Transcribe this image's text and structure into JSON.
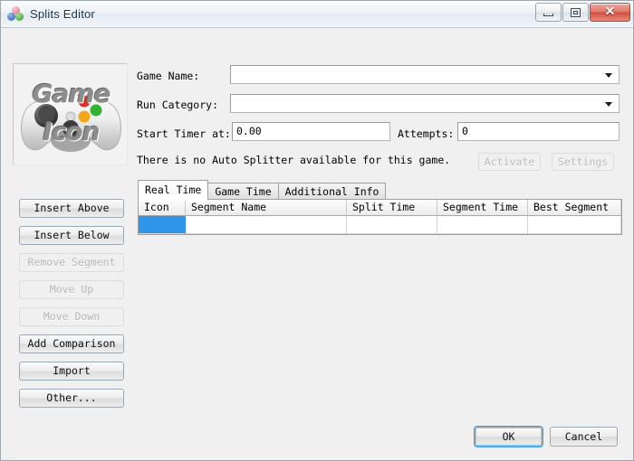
{
  "window": {
    "title": "Splits Editor",
    "icon": "livesplit-icon",
    "controls": {
      "minimize": "minimize-icon",
      "maximize": "maximize-icon",
      "close": "close-icon",
      "close_glyph": "✕"
    }
  },
  "game_icon": {
    "line1": "Game",
    "line2": "Icon",
    "image": "gamepad-placeholder"
  },
  "form": {
    "game_name_label": "Game Name:",
    "game_name_value": "",
    "run_category_label": "Run Category:",
    "run_category_value": "",
    "start_timer_label": "Start Timer at:",
    "start_timer_value": "0.00",
    "attempts_label": "Attempts:",
    "attempts_value": "0",
    "auto_splitter_note": "There is no Auto Splitter available for this game.",
    "activate_label": "Activate",
    "settings_label": "Settings"
  },
  "side_buttons": [
    {
      "label": "Insert Above",
      "enabled": true
    },
    {
      "label": "Insert Below",
      "enabled": true
    },
    {
      "label": "Remove Segment",
      "enabled": false
    },
    {
      "label": "Move Up",
      "enabled": false
    },
    {
      "label": "Move Down",
      "enabled": false
    },
    {
      "label": "Add Comparison",
      "enabled": true
    },
    {
      "label": "Import",
      "enabled": true
    },
    {
      "label": "Other...",
      "enabled": true
    }
  ],
  "tabs": [
    {
      "label": "Real Time",
      "active": true
    },
    {
      "label": "Game Time",
      "active": false
    },
    {
      "label": "Additional Info",
      "active": false
    }
  ],
  "table": {
    "columns": [
      "Icon",
      "Segment Name",
      "Split Time",
      "Segment Time",
      "Best Segment"
    ],
    "rows": [
      {
        "icon": "",
        "segment_name": "",
        "split_time": "",
        "segment_time": "",
        "best_segment": "",
        "selected_cell": "icon"
      }
    ]
  },
  "footer": {
    "ok_label": "OK",
    "cancel_label": "Cancel"
  },
  "colors": {
    "selection_blue": "#2f95e8",
    "dialog_bg": "#f0f0f0",
    "close_red": "#cf4f3f",
    "focus_blue": "#3c9ede"
  }
}
